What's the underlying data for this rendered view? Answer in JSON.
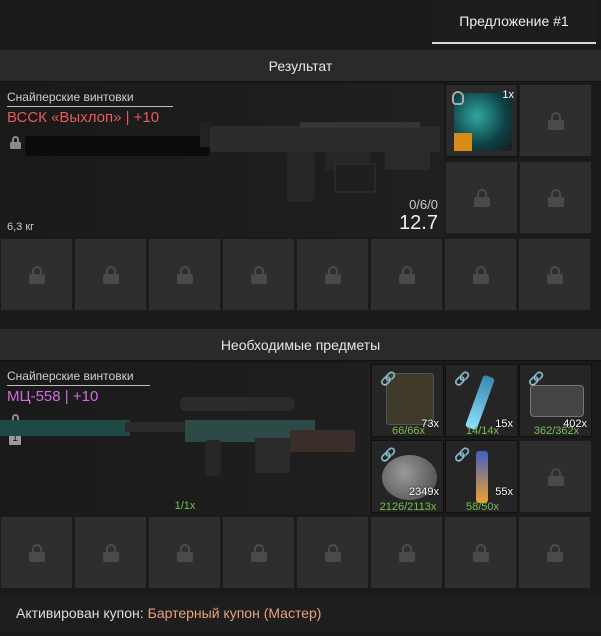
{
  "tab": {
    "label": "Предложение #1"
  },
  "result": {
    "header": "Результат",
    "category": "Снайперские винтовки",
    "weapon": "ВССК «Выхлоп» | +10",
    "weight": "6,3 кг",
    "ammo": "0/6/0",
    "value": "12.7",
    "skin_qty": "1x"
  },
  "required": {
    "header": "Необходимые предметы",
    "category": "Снайперские винтовки",
    "weapon": "МЦ-558 | +10",
    "lock_level": "1",
    "weapon_count": "1/1x",
    "items": [
      {
        "name": "ammo-box-icon",
        "qty": "73x",
        "count": "66/66x"
      },
      {
        "name": "syringe-icon",
        "qty": "15x",
        "count": "14/14x"
      },
      {
        "name": "device-plate-icon",
        "qty": "402x",
        "count": "362/362x"
      },
      {
        "name": "smoke-material-icon",
        "qty": "2349x",
        "count": "2126/2113x"
      },
      {
        "name": "orange-syringe-icon",
        "qty": "55x",
        "count": "58/50x"
      }
    ]
  },
  "footer": {
    "label": "Активирован купон:",
    "coupon": "Бартерный купон (Мастер)"
  },
  "colors": {
    "red_name": "#e85a5a",
    "purple_name": "#d46ae0",
    "green_count": "#7bbf4f",
    "coupon": "#e8a37a"
  }
}
